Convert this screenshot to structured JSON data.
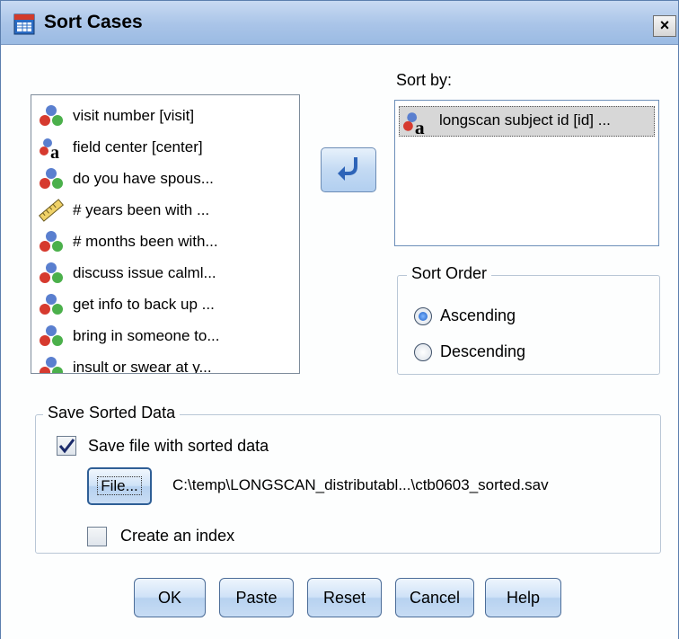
{
  "window": {
    "title": "Sort Cases",
    "close_glyph": "×"
  },
  "variables": {
    "items": [
      {
        "label": "visit number [visit]",
        "icon": "nominal-icon"
      },
      {
        "label": "field center [center]",
        "icon": "string-icon"
      },
      {
        "label": "do you have spous...",
        "icon": "nominal-icon"
      },
      {
        "label": "# years been with ...",
        "icon": "scale-icon"
      },
      {
        "label": "# months been with...",
        "icon": "nominal-icon"
      },
      {
        "label": "discuss issue calml...",
        "icon": "nominal-icon"
      },
      {
        "label": "get info to back up ...",
        "icon": "nominal-icon"
      },
      {
        "label": "bring in someone to...",
        "icon": "nominal-icon"
      },
      {
        "label": "insult or swear at y...",
        "icon": "nominal-icon"
      }
    ]
  },
  "sort_by": {
    "label": "Sort by:",
    "items": [
      {
        "label": "longscan subject id [id] ...",
        "icon": "string-icon"
      }
    ]
  },
  "sort_order": {
    "legend": "Sort Order",
    "options": [
      {
        "label": "Ascending",
        "selected": true
      },
      {
        "label": "Descending",
        "selected": false
      }
    ]
  },
  "save_sorted": {
    "legend": "Save Sorted Data",
    "save_file_label": "Save file with sorted data",
    "save_file_checked": true,
    "file_button": "File...",
    "file_path": "C:\\temp\\LONGSCAN_distributabl...\\ctb0603_sorted.sav",
    "index_label": "Create an index",
    "index_checked": false
  },
  "buttons": {
    "ok": "OK",
    "paste": "Paste",
    "reset": "Reset",
    "cancel": "Cancel",
    "help": "Help"
  },
  "colors": {
    "title_bar": "#a9c4e8",
    "accent": "#2f86d3",
    "selection": "#d7d7d7"
  }
}
